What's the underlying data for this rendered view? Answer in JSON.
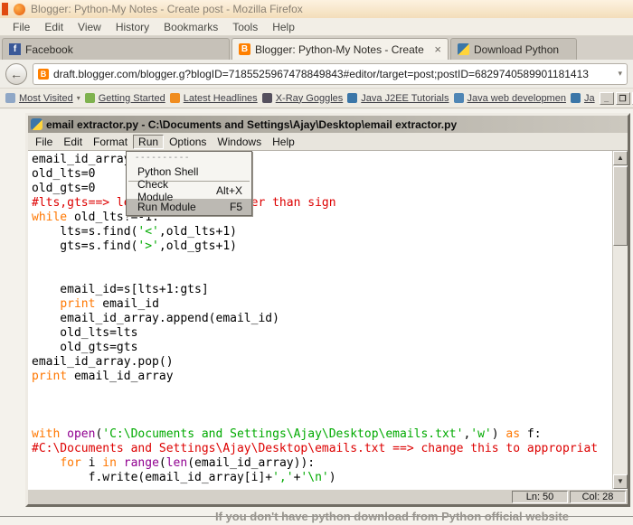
{
  "firefox": {
    "title": "Blogger: Python-My Notes - Create post - Mozilla Firefox",
    "menu": [
      "File",
      "Edit",
      "View",
      "History",
      "Bookmarks",
      "Tools",
      "Help"
    ],
    "tabs": [
      {
        "label": "Facebook"
      },
      {
        "label": "Blogger: Python-My Notes - Create post",
        "close": "×"
      },
      {
        "label": "Download Python"
      }
    ],
    "nav": {
      "url": "draft.blogger.com/blogger.g?blogID=7185525967478849843#editor/target=post;postID=6829740589901181413"
    },
    "bookmarks": [
      "Most Visited",
      "Getting Started",
      "Latest Headlines",
      "X-Ray Goggles",
      "Java J2EE Tutorials",
      "Java web developmen",
      "Ja"
    ],
    "window_buttons": {
      "minimize": "_",
      "maximize": "❐",
      "close": "✕"
    },
    "page_text": "If you don't have python download from Python official website"
  },
  "idle": {
    "title": "email extractor.py - C:\\Documents and Settings\\Ajay\\Desktop\\email extractor.py",
    "menu": [
      "File",
      "Edit",
      "Format",
      "Run",
      "Options",
      "Windows",
      "Help"
    ],
    "run_menu": {
      "tearoff": "- - - - - - - - - -",
      "items": [
        {
          "label": "Python Shell",
          "shortcut": ""
        },
        {
          "label": "Check Module",
          "shortcut": "Alt+X"
        },
        {
          "label": "Run Module",
          "shortcut": "F5"
        }
      ]
    },
    "status": {
      "line": "Ln: 50",
      "col": "Col: 28"
    }
  },
  "icons": {
    "facebook": "f",
    "blogger": "B",
    "back_arrow": "←",
    "url_dropdown": "▾",
    "most_visited_dropdown": "▾",
    "scroll_up": "▲",
    "scroll_down": "▼"
  },
  "colors": {
    "keyword": "#ff7700",
    "string": "#00aa00",
    "comment": "#dd0000",
    "builtin": "#900090"
  },
  "code": {
    "lines": [
      [
        [
          "p",
          "email_id_array=[]"
        ]
      ],
      [
        [
          "p",
          "old_lts=0"
        ]
      ],
      [
        [
          "p",
          "old_gts=0"
        ]
      ],
      [
        [
          "c",
          "#lts,gts==> less than and greater than sign"
        ]
      ],
      [
        [
          "k",
          "while"
        ],
        [
          "p",
          " old_lts!=-1:"
        ]
      ],
      [
        [
          "p",
          "    lts=s.find("
        ],
        [
          "s",
          "'<'"
        ],
        [
          "p",
          ",old_lts+1)"
        ]
      ],
      [
        [
          "p",
          "    gts=s.find("
        ],
        [
          "s",
          "'>'"
        ],
        [
          "p",
          ",old_gts+1)"
        ]
      ],
      [],
      [],
      [
        [
          "p",
          "    email_id=s[lts+1:gts]"
        ]
      ],
      [
        [
          "p",
          "    "
        ],
        [
          "k",
          "print"
        ],
        [
          "p",
          " email_id"
        ]
      ],
      [
        [
          "p",
          "    email_id_array.append(email_id)"
        ]
      ],
      [
        [
          "p",
          "    old_lts=lts"
        ]
      ],
      [
        [
          "p",
          "    old_gts=gts"
        ]
      ],
      [
        [
          "p",
          "email_id_array.pop()"
        ]
      ],
      [
        [
          "k",
          "print"
        ],
        [
          "p",
          " email_id_array"
        ]
      ],
      [],
      [],
      [],
      [
        [
          "k",
          "with"
        ],
        [
          "p",
          " "
        ],
        [
          "b",
          "open"
        ],
        [
          "p",
          "("
        ],
        [
          "s",
          "'C:\\Documents and Settings\\Ajay\\Desktop\\emails.txt'"
        ],
        [
          "p",
          ","
        ],
        [
          "s",
          "'w'"
        ],
        [
          "p",
          ") "
        ],
        [
          "k",
          "as"
        ],
        [
          "p",
          " f:"
        ]
      ],
      [
        [
          "c",
          "#C:\\Documents and Settings\\Ajay\\Desktop\\emails.txt ==> change this to appropriat"
        ]
      ],
      [
        [
          "p",
          "    "
        ],
        [
          "k",
          "for"
        ],
        [
          "p",
          " i "
        ],
        [
          "k",
          "in"
        ],
        [
          "p",
          " "
        ],
        [
          "b",
          "range"
        ],
        [
          "p",
          "("
        ],
        [
          "b",
          "len"
        ],
        [
          "p",
          "(email_id_array)):"
        ]
      ],
      [
        [
          "p",
          "        f.write(email_id_array[i]+"
        ],
        [
          "s",
          "','"
        ],
        [
          "p",
          "+"
        ],
        [
          "s",
          "'\\n'"
        ],
        [
          "p",
          ")"
        ]
      ]
    ]
  }
}
